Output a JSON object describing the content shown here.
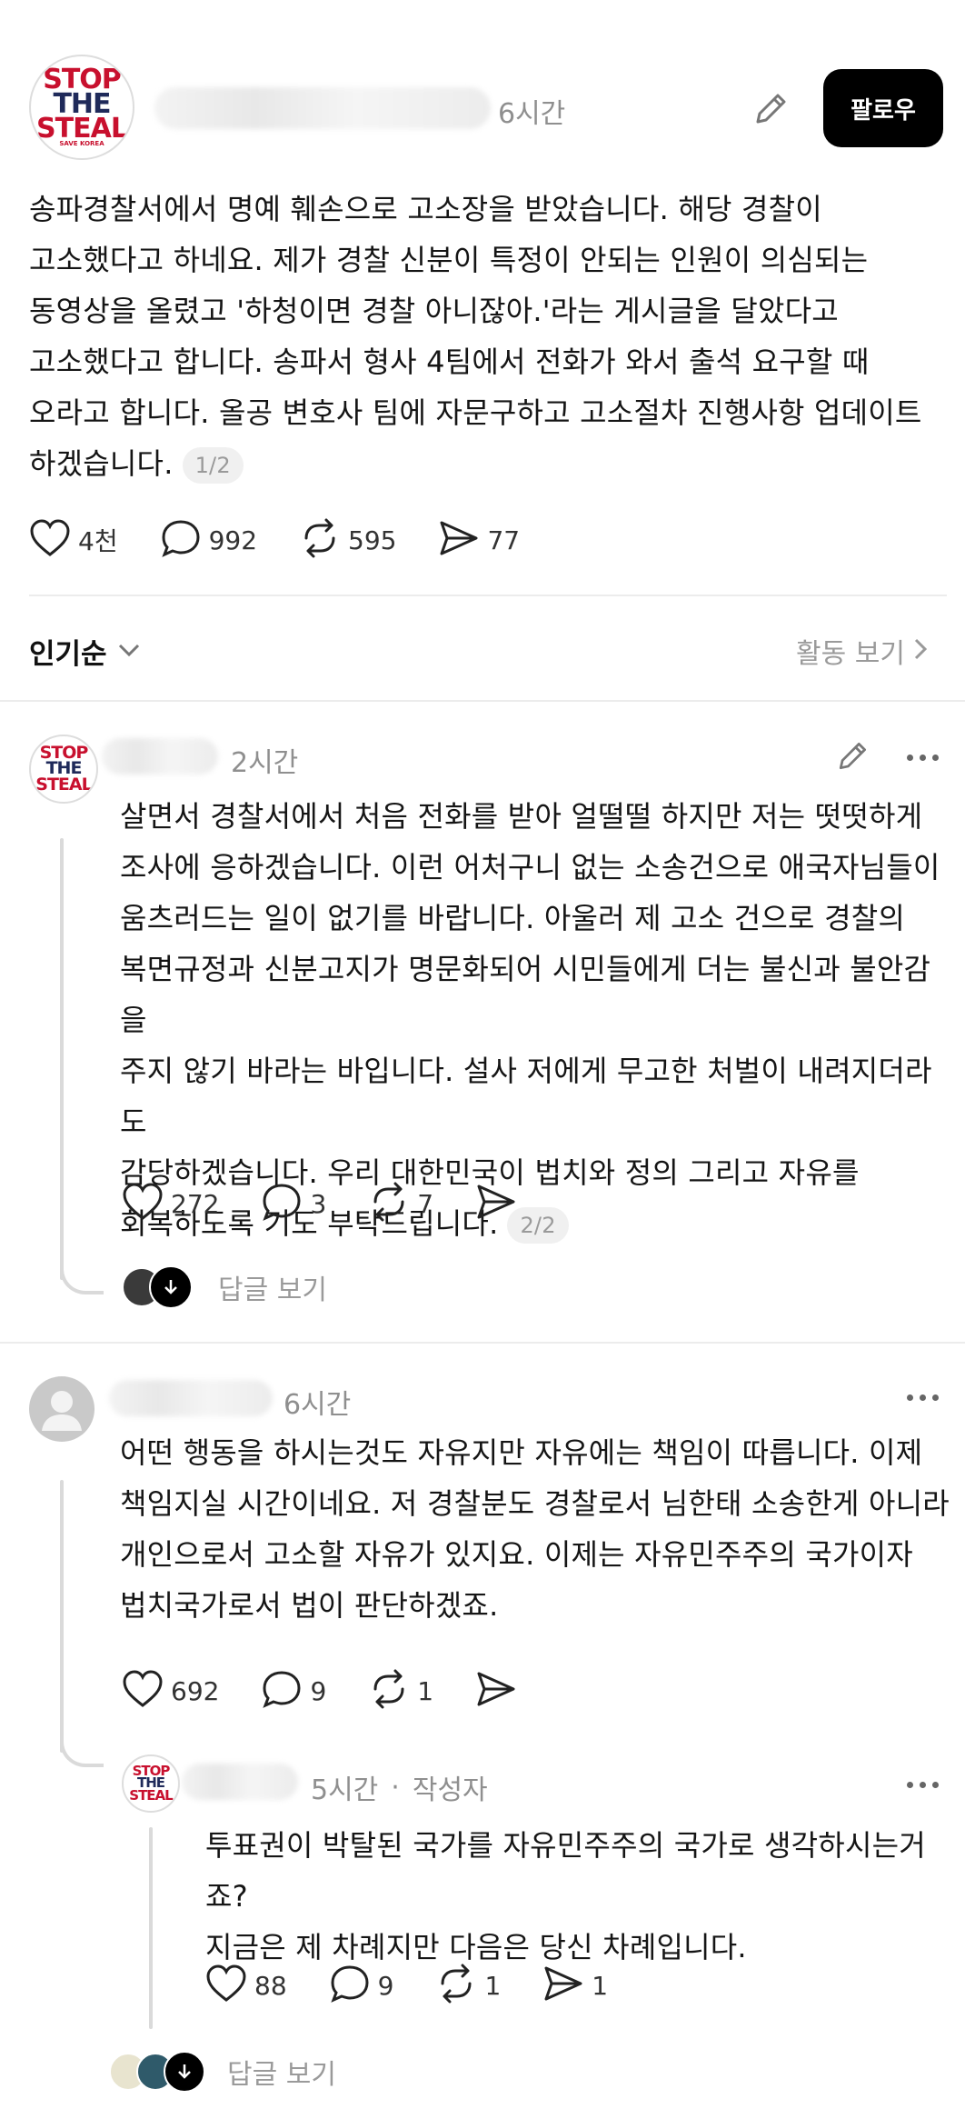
{
  "post": {
    "time": "6시간",
    "follow_label": "팔로우",
    "avatar_logo": [
      "STOP",
      "THE",
      "STEAL"
    ],
    "avatar_sub": "SAVE KOREA",
    "lines": [
      "송파경찰서에서 명예 훼손으로 고소장을 받았습니다. 해당 경찰이",
      "고소했다고 하네요.  제가 경찰 신분이 특정이 안되는 인원이 의심되는",
      "동영상을 올렸고 '하청이면 경찰 아니잖아.'라는 게시글을 달았다고",
      "고소했다고 합니다. 송파서 형사 4팀에서 전화가 와서 출석 요구할 때",
      "오라고 합니다. 올공 변호사 팀에 자문구하고 고소절차 진행사항 업데이트",
      "하겠습니다."
    ],
    "pager": "1/2",
    "likes": "4천",
    "comments": "992",
    "reposts": "595",
    "shares": "77"
  },
  "sort": {
    "label": "인기순",
    "activity_label": "활동 보기"
  },
  "reply1": {
    "time": "2시간",
    "lines": [
      "살면서 경찰서에서 처음 전화를 받아 얼떨떨 하지만 저는 떳떳하게",
      "조사에 응하겠습니다. 이런 어처구니 없는 소송건으로 애국자님들이",
      "움츠러드는 일이 없기를 바랍니다. 아울러 제 고소 건으로 경찰의",
      "복면규정과 신분고지가 명문화되어 시민들에게 더는 불신과 불안감을",
      "주지 않기 바라는 바입니다. 설사 저에게 무고한 처벌이 내려지더라도",
      "감당하겠습니다. 우리 대한민국이 법치와 정의 그리고 자유를",
      "회복하도록 기도 부탁드립니다."
    ],
    "pager": "2/2",
    "likes": "272",
    "comments": "3",
    "reposts": "7",
    "view_replies": "답글 보기"
  },
  "reply2": {
    "time": "6시간",
    "lines": [
      "어떤 행동을 하시는것도 자유지만 자유에는 책임이 따릅니다. 이제",
      "책임지실 시간이네요. 저 경찰분도 경찰로서 님한태 소송한게 아니라",
      "개인으로서 고소할 자유가 있지요. 이제는 자유민주주의 국가이자",
      "법치국가로서 법이 판단하겠죠."
    ],
    "likes": "692",
    "comments": "9",
    "reposts": "1"
  },
  "reply3": {
    "time": "5시간",
    "author_tag": "작성자",
    "separator": "·",
    "lines": [
      "투표권이 박탈된 국가를 자유민주주의 국가로 생각하시는거죠?",
      "지금은 제 차례지만 다음은 당신 차례입니다."
    ],
    "likes": "88",
    "comments": "9",
    "reposts": "1",
    "shares": "1",
    "view_replies": "답글 보기"
  },
  "colors": {
    "logo_red": "#c8102e",
    "logo_navy": "#1f2a5a",
    "button_bg": "#000000",
    "muted_text": "#9a9a9a"
  }
}
